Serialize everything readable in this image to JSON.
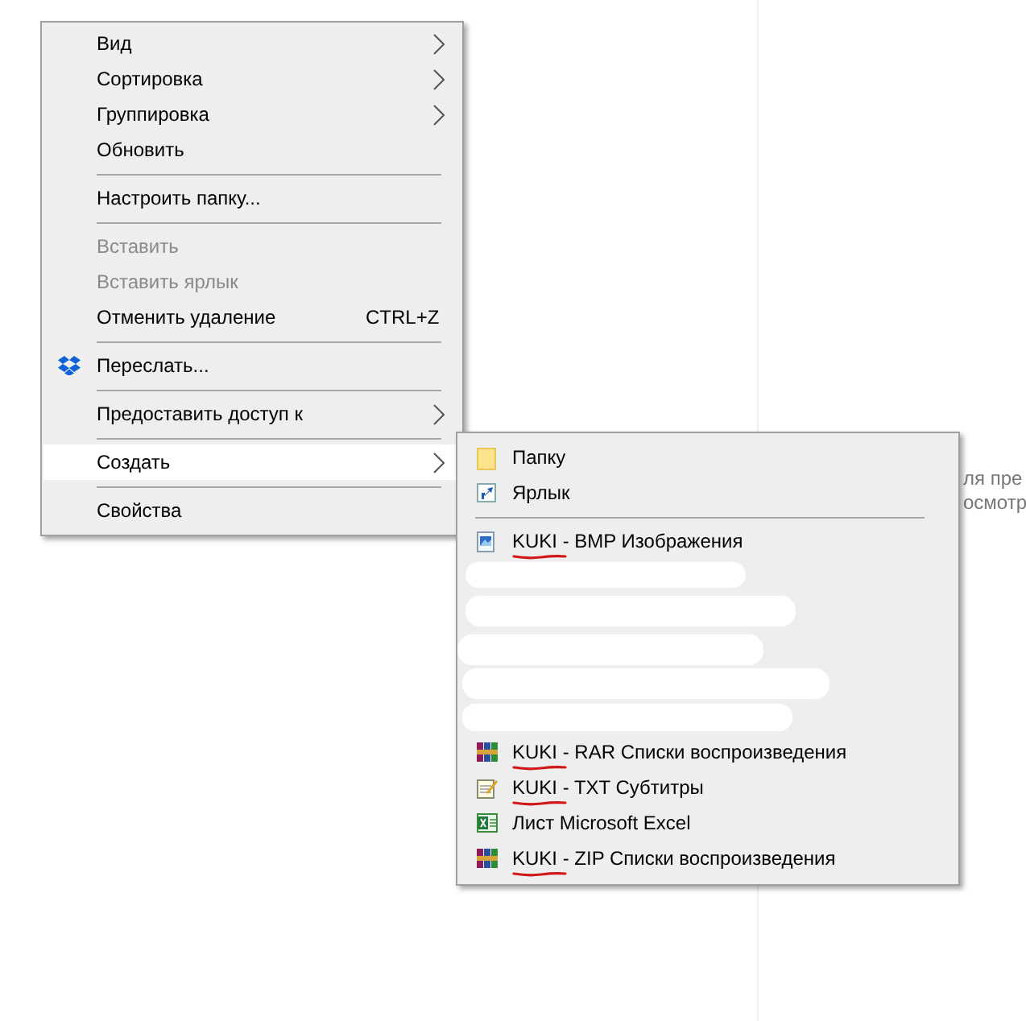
{
  "background_text": [
    "ля пре",
    "осмотр"
  ],
  "context_menu": {
    "items": [
      {
        "kind": "item",
        "label": "Вид",
        "disabled": false,
        "submenu": true,
        "selected": false
      },
      {
        "kind": "item",
        "label": "Сортировка",
        "disabled": false,
        "submenu": true,
        "selected": false
      },
      {
        "kind": "item",
        "label": "Группировка",
        "disabled": false,
        "submenu": true,
        "selected": false
      },
      {
        "kind": "item",
        "label": "Обновить",
        "disabled": false,
        "submenu": false,
        "selected": false
      },
      {
        "kind": "separator"
      },
      {
        "kind": "item",
        "label": "Настроить папку...",
        "disabled": false,
        "submenu": false,
        "selected": false
      },
      {
        "kind": "separator"
      },
      {
        "kind": "item",
        "label": "Вставить",
        "disabled": true,
        "submenu": false,
        "selected": false
      },
      {
        "kind": "item",
        "label": "Вставить ярлык",
        "disabled": true,
        "submenu": false,
        "selected": false
      },
      {
        "kind": "item",
        "label": "Отменить удаление",
        "shortcut": "CTRL+Z",
        "disabled": false,
        "submenu": false,
        "selected": false
      },
      {
        "kind": "separator"
      },
      {
        "kind": "item",
        "label": "Переслать...",
        "disabled": false,
        "submenu": false,
        "selected": false
      },
      {
        "kind": "separator"
      },
      {
        "kind": "item",
        "label": "Предоставить доступ к",
        "disabled": false,
        "submenu": true,
        "selected": false
      },
      {
        "kind": "separator"
      },
      {
        "kind": "item",
        "label": "Создать",
        "disabled": false,
        "submenu": true,
        "selected": true
      },
      {
        "kind": "separator"
      },
      {
        "kind": "item",
        "label": "Свойства",
        "disabled": false,
        "submenu": false,
        "selected": false
      }
    ]
  },
  "submenu": {
    "items": [
      {
        "kind": "item",
        "label": "Папку",
        "underlined": false
      },
      {
        "kind": "item",
        "label": "Ярлык",
        "underlined": false
      },
      {
        "kind": "separator"
      },
      {
        "kind": "item",
        "label": "KUKI - BMP Изображения",
        "underlined": true
      },
      {
        "kind": "redacted"
      },
      {
        "kind": "item",
        "label": "KUKI - RAR Списки воспроизведения",
        "underlined": true
      },
      {
        "kind": "item",
        "label": "KUKI - TXT Субтитры",
        "underlined": true
      },
      {
        "kind": "item",
        "label": "Лист Microsoft Excel",
        "underlined": false
      },
      {
        "kind": "item",
        "label": "KUKI - ZIP Списки воспроизведения",
        "underlined": true
      }
    ]
  }
}
